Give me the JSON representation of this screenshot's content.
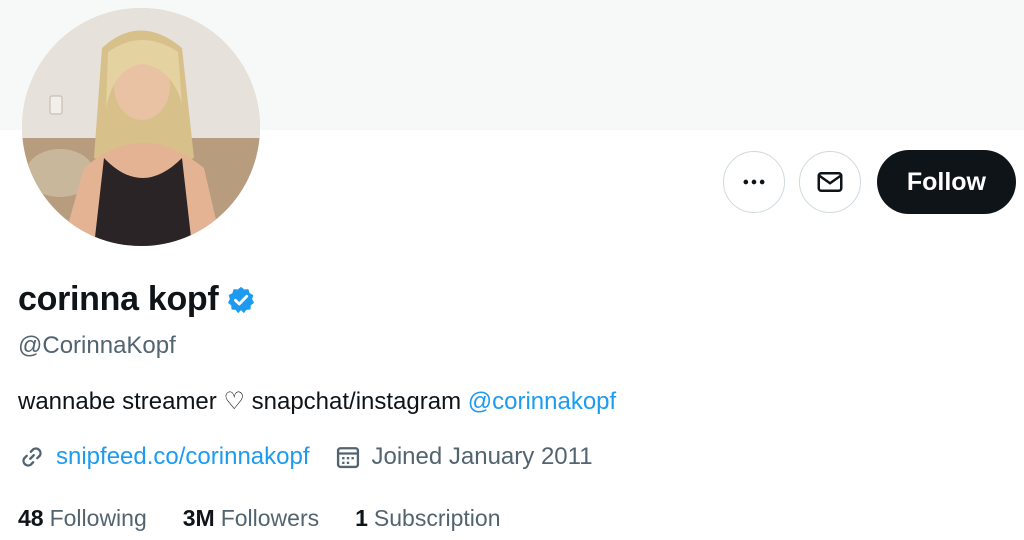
{
  "profile": {
    "display_name": "corinna kopf",
    "handle": "@CorinnaKopf",
    "bio_text": "wannabe streamer ♡ snapchat/instagram ",
    "bio_mention": "@corinnakopf",
    "website": "snipfeed.co/corinnakopf",
    "joined": "Joined January 2011",
    "verified": true
  },
  "actions": {
    "more_icon": "more-dots-icon",
    "message_icon": "envelope-icon",
    "follow_label": "Follow"
  },
  "stats": {
    "following_count": "48",
    "following_label": "Following",
    "followers_count": "3M",
    "followers_label": "Followers",
    "subscription_count": "1",
    "subscription_label": "Subscription"
  },
  "colors": {
    "accent": "#1d9bf0",
    "text_primary": "#0f1419",
    "text_secondary": "#536471",
    "follow_bg": "#0f1419",
    "banner_bg": "#f7f9f9",
    "border": "#cfd9de"
  }
}
